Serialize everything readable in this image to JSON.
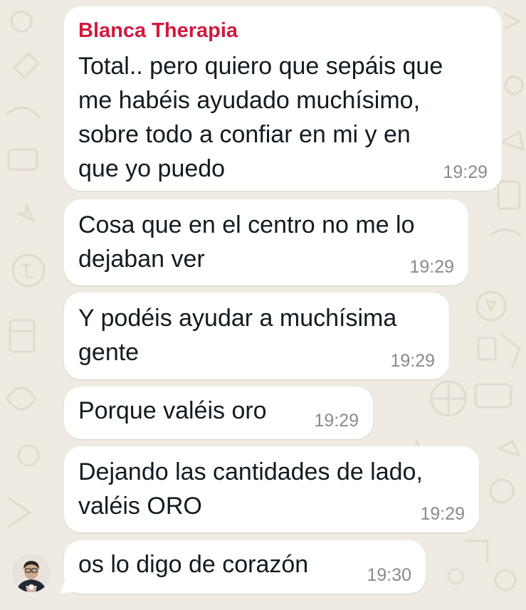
{
  "chat": {
    "sender": "Blanca Therapia",
    "messages": [
      {
        "text": "Total.. pero quiero que sepáis que\nme habéis ayudado muchísimo,\nsobre todo a confiar en mi y en\nque yo puedo",
        "time": "19:29"
      },
      {
        "text": "Cosa que en el centro no me lo\ndejaban ver",
        "time": "19:29"
      },
      {
        "text": "Y podéis ayudar a muchísima\ngente",
        "time": "19:29"
      },
      {
        "text": "Porque valéis oro",
        "time": "19:29"
      },
      {
        "text": "Dejando las cantidades de lado,\nvaléis ORO",
        "time": "19:29"
      },
      {
        "text": "os lo digo de corazón",
        "time": "19:30"
      }
    ]
  },
  "colors": {
    "background": "#efeae2",
    "bubble": "#ffffff",
    "sender_name": "#d01a40",
    "message_text": "#111b21",
    "timestamp": "#8a8a8a"
  },
  "avatar": {
    "icon": "contact-avatar-icon"
  }
}
